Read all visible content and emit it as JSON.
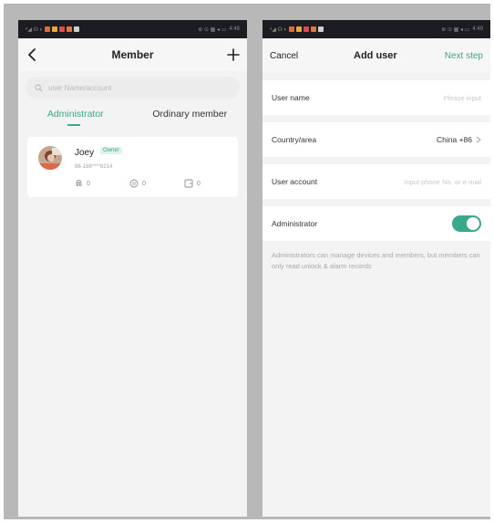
{
  "colors": {
    "accent": "#3aa88a",
    "statusbar": "#1b1d22"
  },
  "status_bar": {
    "left_time": "4:48",
    "right_time": "4:49"
  },
  "member_screen": {
    "title": "Member",
    "back_icon": "chevron-left-icon",
    "add_icon": "plus-icon",
    "search_placeholder": "user Name/account",
    "tabs": [
      {
        "label": "Administrator",
        "active": true
      },
      {
        "label": "Ordinary member",
        "active": false
      }
    ],
    "member": {
      "name": "Joey",
      "badge": "Owner",
      "phone": "86-188****8214",
      "stats": [
        {
          "icon": "fingerprint-icon",
          "count": "0"
        },
        {
          "icon": "password-icon",
          "count": "0"
        },
        {
          "icon": "card-icon",
          "count": "0"
        }
      ]
    }
  },
  "add_user_screen": {
    "cancel_label": "Cancel",
    "title": "Add user",
    "next_label": "Next step",
    "fields": {
      "username": {
        "label": "User name",
        "placeholder": "Please input"
      },
      "country": {
        "label": "Country/area",
        "value": "China +86"
      },
      "account": {
        "label": "User account",
        "placeholder": "Input phone No. or e-mail"
      },
      "admin": {
        "label": "Administrator",
        "enabled": true
      }
    },
    "note": "Administrators can manage devices and members, but members can only read unlock & alarm records"
  }
}
